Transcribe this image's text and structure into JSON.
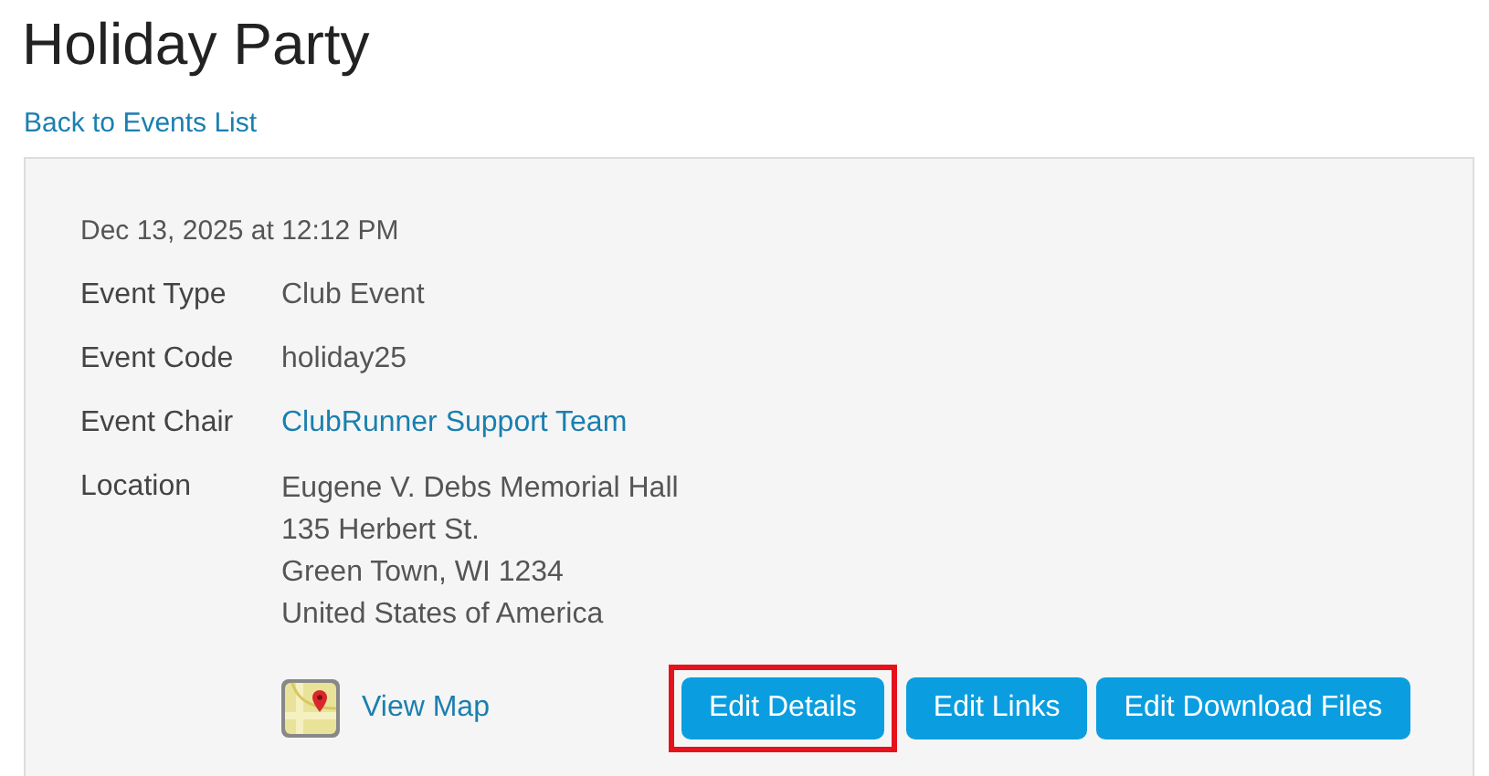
{
  "title": "Holiday Party",
  "back_link": "Back to Events List",
  "date": "Dec 13, 2025 at 12:12 PM",
  "details": [
    {
      "label": "Event Type",
      "value": "Club Event",
      "kind": "text"
    },
    {
      "label": "Event Code",
      "value": "holiday25",
      "kind": "text"
    },
    {
      "label": "Event Chair",
      "value": "ClubRunner Support Team",
      "kind": "link"
    }
  ],
  "location": {
    "label": "Location",
    "lines": [
      "Eugene V. Debs Memorial Hall",
      "135 Herbert St.",
      "Green Town, WI 1234",
      "United States of America"
    ]
  },
  "map_link": "View Map",
  "buttons": [
    {
      "label": "Edit Details",
      "highlighted": true
    },
    {
      "label": "Edit Links",
      "highlighted": false
    },
    {
      "label": "Edit Download Files",
      "highlighted": false
    }
  ]
}
